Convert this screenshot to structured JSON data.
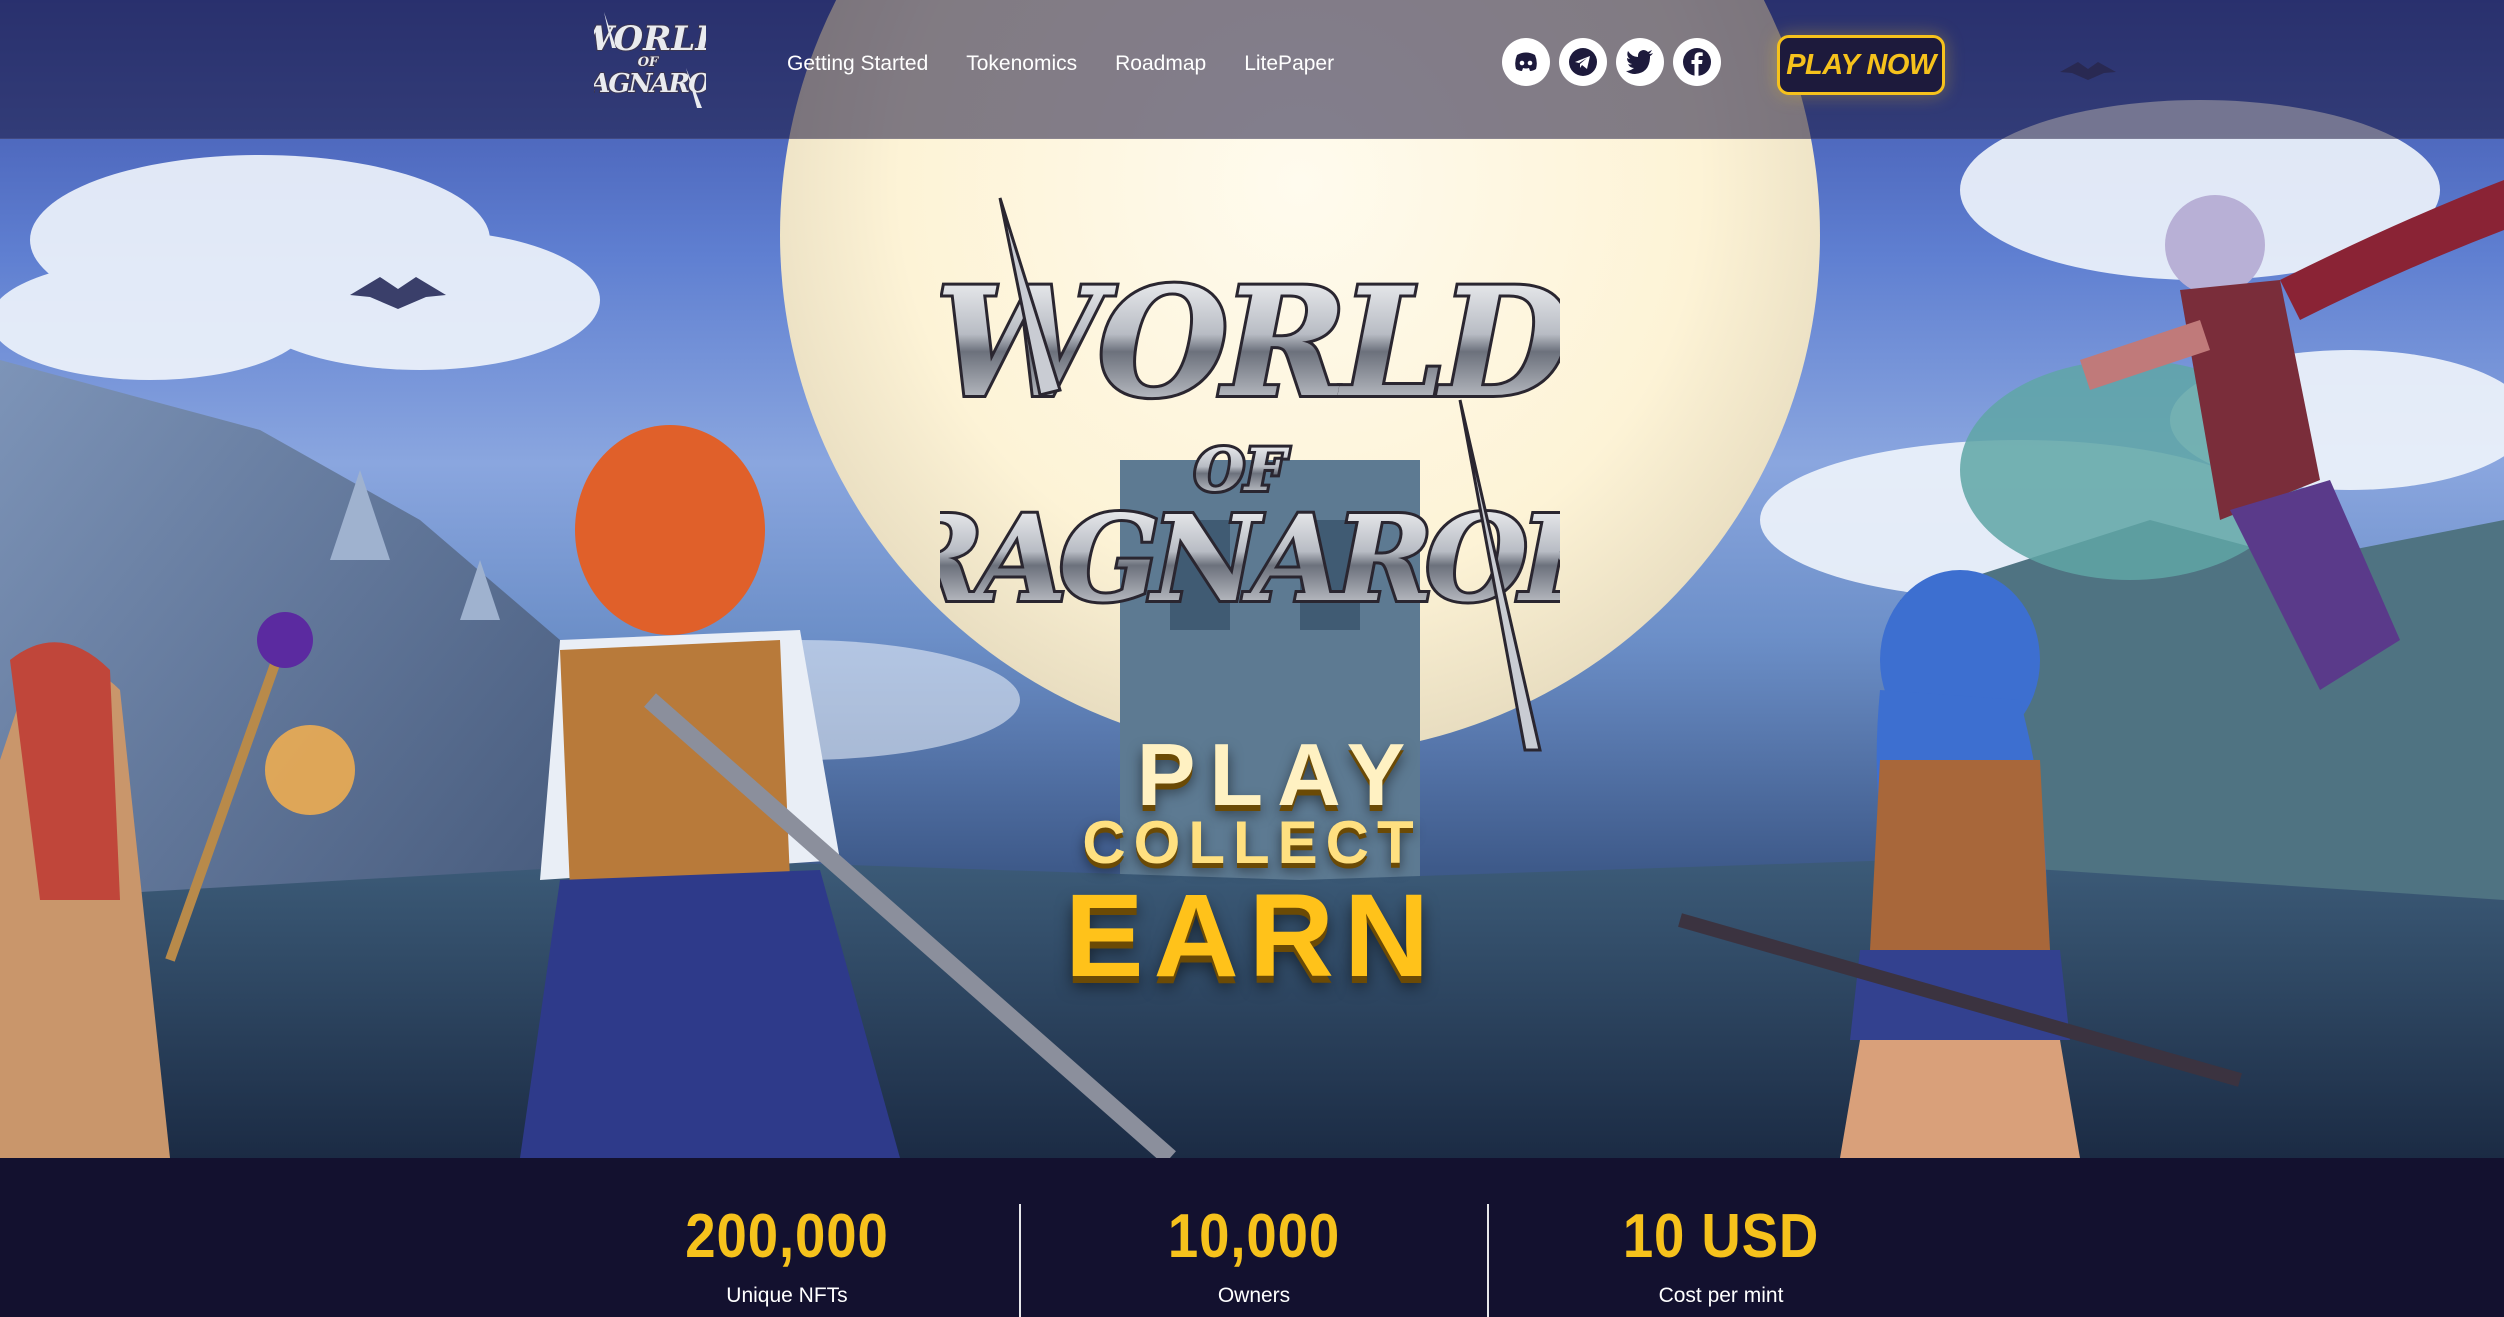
{
  "header": {
    "logo_alt": "World of Ragnarok",
    "nav": [
      {
        "label": "Getting Started"
      },
      {
        "label": "Tokenomics"
      },
      {
        "label": "Roadmap"
      },
      {
        "label": "LitePaper"
      }
    ],
    "socials": [
      {
        "icon": "discord-icon"
      },
      {
        "icon": "telegram-icon"
      },
      {
        "icon": "twitter-icon"
      },
      {
        "icon": "facebook-icon"
      }
    ],
    "cta_label": "PLAY NOW"
  },
  "hero": {
    "logo_line1": "WORLD",
    "logo_line2": "OF",
    "logo_line3": "RAGNAROK",
    "tagline_1": "PLAY",
    "tagline_2": "COLLECT",
    "tagline_3": "EARN"
  },
  "stats": [
    {
      "value": "200,000",
      "label": "Unique NFTs"
    },
    {
      "value": "10,000",
      "label": "Owners"
    },
    {
      "value": "10 USD",
      "label": "Cost per mint"
    }
  ],
  "colors": {
    "accent": "#f6c21c",
    "header_bg": "#2a2552",
    "stats_bg": "#13112f"
  }
}
